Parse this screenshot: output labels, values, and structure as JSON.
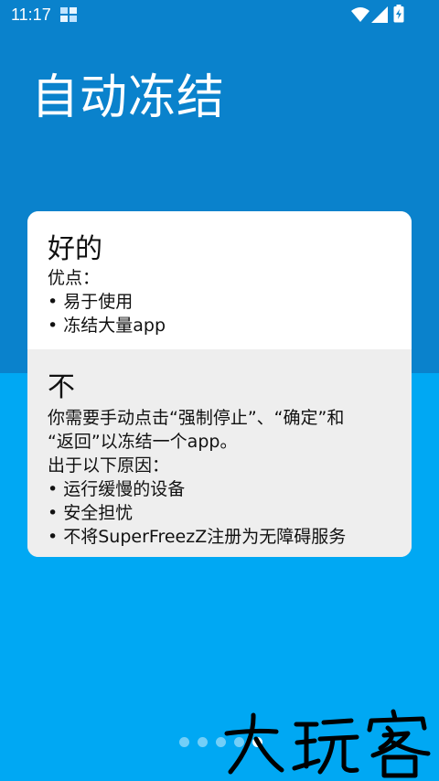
{
  "status_bar": {
    "time": "11:17",
    "icons": [
      "notification-icon",
      "wifi-icon",
      "signal-icon",
      "battery-charging-icon"
    ]
  },
  "title": "自动冻结",
  "good": {
    "heading": "好的",
    "lines": [
      "优点：",
      "• 易于使用",
      "• 冻结大量app"
    ]
  },
  "bad": {
    "heading": "不",
    "lines": [
      "你需要手动点击“强制停止”、“确定”和",
      "“返回”以冻结一个app。",
      "出于以下原因：",
      "• 运行缓慢的设备",
      "• 安全担忧",
      "• 不将SuperFreezZ注册为无障碍服务"
    ]
  },
  "pager": {
    "total": 5,
    "active_index": 4
  },
  "watermark": {
    "text": "大玩客"
  },
  "colors": {
    "top_background": "#0a82cc",
    "bottom_background": "#00a8f3",
    "good_card": "#ffffff",
    "bad_card": "#eeeeee"
  }
}
